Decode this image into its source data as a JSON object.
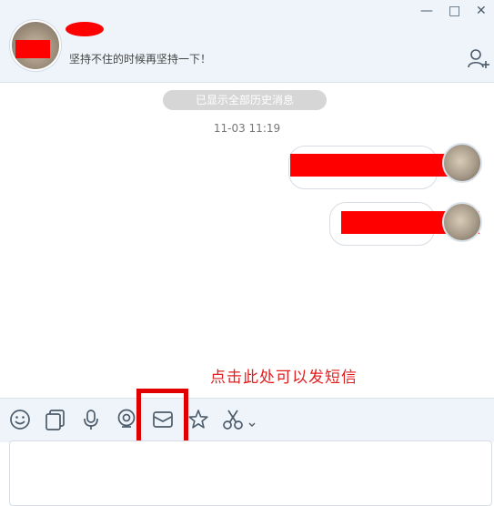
{
  "header": {
    "signature": "坚持不住的时候再坚持一下！",
    "window_buttons": {
      "minimize": "—",
      "maximize": "□",
      "close": "✕"
    }
  },
  "chat": {
    "history_notice": "已显示全部历史消息",
    "timestamp": "11-03 11:19"
  },
  "annotation": {
    "hint": "点击此处可以发短信"
  },
  "toolbar": {
    "icons": [
      "emoji-icon",
      "screenshot-window-icon",
      "microphone-icon",
      "webcam-icon",
      "sms-envelope-icon",
      "favorite-star-icon",
      "scissors-icon"
    ]
  },
  "colors": {
    "accent_red": "#e02020",
    "header_bg": "#eef4fa"
  }
}
